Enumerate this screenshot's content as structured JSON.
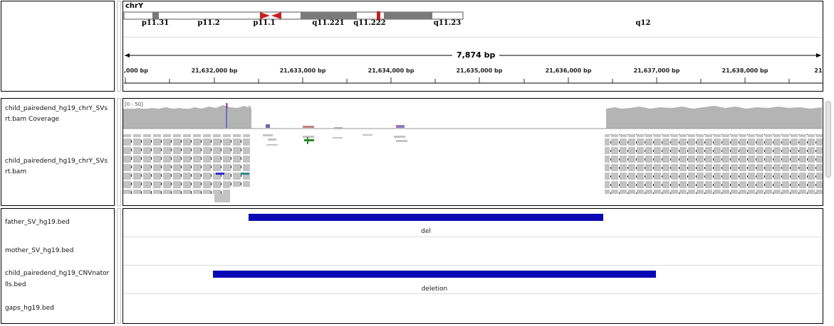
{
  "header": {
    "chromosome": "chrY",
    "span_label": "7,874 bp",
    "bands": [
      {
        "label": "p11.31"
      },
      {
        "label": "p11.2"
      },
      {
        "label": "p11.1"
      },
      {
        "label": "q11.221"
      },
      {
        "label": "q11.222"
      },
      {
        "label": "q11.23"
      },
      {
        "label": "q12"
      }
    ],
    "ruler_ticks": [
      ",000 bp",
      "21,632,000 bp",
      "21,633,000 bp",
      "21,634,000 bp",
      "21,635,000 bp",
      "21,636,000 bp",
      "21,637,000 bp",
      "21,638,000 bp",
      "21"
    ]
  },
  "tracks": {
    "coverage": {
      "name_line1": "child_pairedend_hg19_chrY_SVs",
      "name_line2": "rt.bam Coverage",
      "range": "[0 - 50]"
    },
    "alignment": {
      "name_line1": "child_pairedend_hg19_chrY_SVs",
      "name_line2": "rt.bam"
    },
    "features": [
      {
        "name_line1": "father_SV_hg19.bed",
        "name_line2": "",
        "feature_label": "del"
      },
      {
        "name_line1": "mother_SV_hg19.bed",
        "name_line2": "",
        "feature_label": ""
      },
      {
        "name_line1": "child_pairedend_hg19_CNVnator",
        "name_line2": "lls.bed",
        "feature_label": "deletion"
      },
      {
        "name_line1": "gaps_hg19.bed",
        "name_line2": "",
        "feature_label": ""
      }
    ]
  },
  "colors": {
    "feature": "#0a0ab4",
    "coverage": "#b4b4b4",
    "reads": "#c3c3c3",
    "centromere": "#c81e1e"
  }
}
